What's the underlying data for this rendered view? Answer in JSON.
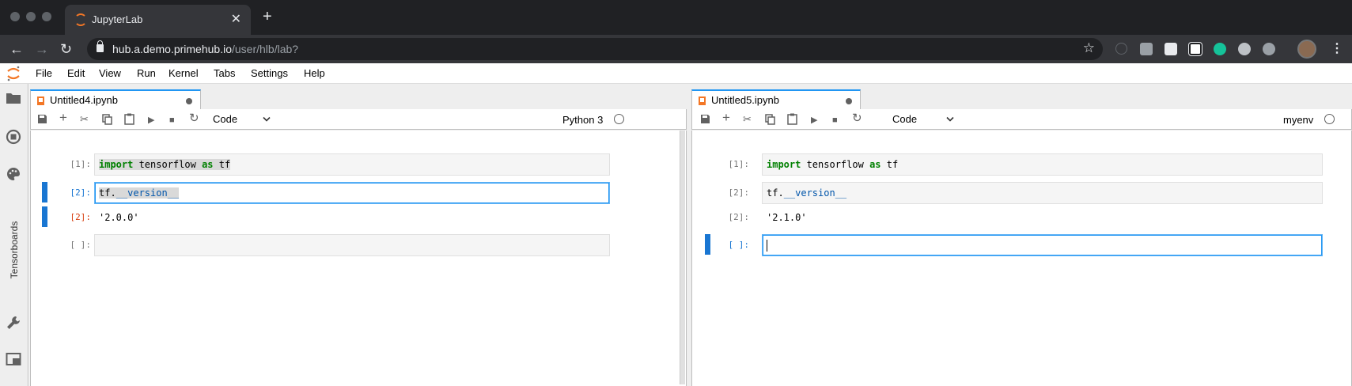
{
  "browser": {
    "tab_title": "JupyterLab",
    "tab_close": "✕",
    "new_tab": "+",
    "url_host": "hub.a.demo.primehub.io",
    "url_path": "/user/hlb/lab?",
    "star": "☆"
  },
  "menu": {
    "items": [
      "File",
      "Edit",
      "View",
      "Run",
      "Kernel",
      "Tabs",
      "Settings",
      "Help"
    ]
  },
  "sidebar": {
    "vertical_label": "Tensorboards"
  },
  "left_notebook": {
    "tab_title": "Untitled4.ipynb",
    "cell_type": "Code",
    "kernel": "Python 3",
    "cells": [
      {
        "prompt": "[1]:",
        "code_kw1": "import",
        "code_mid": " tensorflow ",
        "code_kw2": "as",
        "code_end": " tf"
      },
      {
        "prompt": "[2]:",
        "code_pre": "tf.",
        "code_attr": "__version__"
      },
      {
        "output_prompt": "[2]:",
        "output": "'2.0.0'"
      },
      {
        "prompt": "[ ]:"
      }
    ]
  },
  "right_notebook": {
    "tab_title": "Untitled5.ipynb",
    "cell_type": "Code",
    "kernel": "myenv",
    "cells": [
      {
        "prompt": "[1]:",
        "code_kw1": "import",
        "code_mid": " tensorflow ",
        "code_kw2": "as",
        "code_end": " tf"
      },
      {
        "prompt": "[2]:",
        "code_pre": "tf.",
        "code_attr": "__version__"
      },
      {
        "output_prompt": "[2]:",
        "output": "'2.1.0'"
      },
      {
        "prompt": "[ ]:"
      }
    ]
  },
  "colors": {
    "accent": "#2196f3",
    "prompt_blue": "#1976d2",
    "prompt_red": "#d84315",
    "jupyter_orange": "#f37726"
  }
}
